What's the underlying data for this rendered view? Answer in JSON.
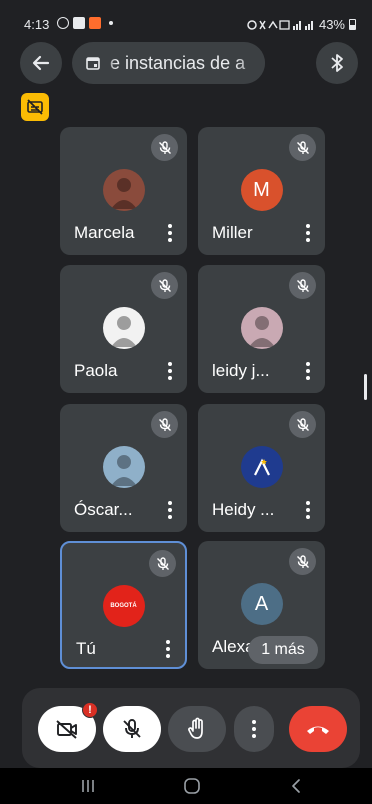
{
  "status_bar": {
    "time": "4:13",
    "battery": "43%",
    "battery_level": 0.43
  },
  "header": {
    "meeting_title": "e instancias de a",
    "back_icon": "arrow-left-icon",
    "bluetooth_icon": "bluetooth-icon",
    "calendar_icon": "calendar-icon"
  },
  "captions_icon": "captions-off-icon",
  "participants": [
    {
      "name": "Marcela",
      "avatar_type": "photo",
      "avatar_color": "#8a4b3c",
      "muted": true
    },
    {
      "name": "Miller",
      "avatar_type": "letter",
      "avatar_letter": "M",
      "avatar_color": "#d9512c",
      "muted": true
    },
    {
      "name": "Paola",
      "avatar_type": "photo",
      "avatar_color": "#f2f2f2",
      "muted": true
    },
    {
      "name": "leidy j...",
      "avatar_type": "photo",
      "avatar_color": "#c9a9b3",
      "muted": true
    },
    {
      "name": "Óscar...",
      "avatar_type": "photo",
      "avatar_color": "#8fb0c9",
      "muted": true
    },
    {
      "name": "Heidy ...",
      "avatar_type": "logo",
      "avatar_color": "#1f3b8f",
      "muted": true
    },
    {
      "name": "Tú",
      "avatar_type": "logo",
      "avatar_color": "#e2231a",
      "avatar_text": "BOGOTÁ",
      "muted": true,
      "self": true
    },
    {
      "name": "Alexa",
      "avatar_type": "letter",
      "avatar_letter": "A",
      "avatar_color": "#4d6e86",
      "muted": true
    }
  ],
  "more_participants": "1 más",
  "controls": {
    "camera_badge": "!",
    "camera_icon": "video-off-icon",
    "mic_icon": "mic-off-icon",
    "hand_icon": "raise-hand-icon",
    "more_icon": "more-vert-icon",
    "hangup_icon": "call-end-icon"
  },
  "colors": {
    "background": "#202124",
    "tile": "#3c4043",
    "hangup": "#ea4335",
    "self_border": "#5f8fd6",
    "captions_badge": "#fbbc04"
  }
}
